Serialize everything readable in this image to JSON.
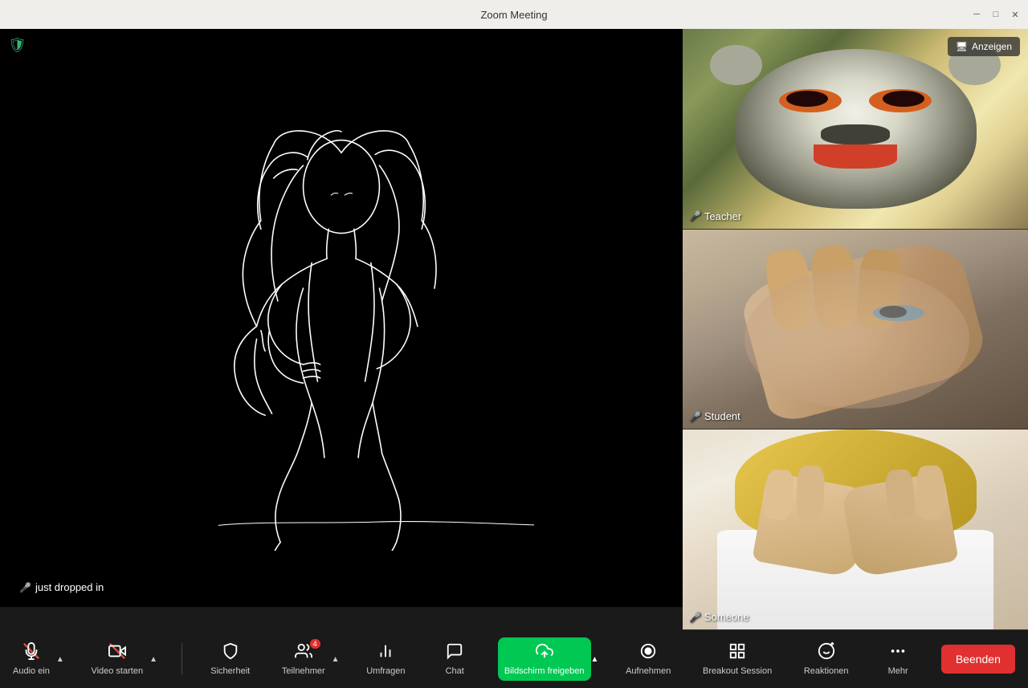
{
  "window": {
    "title": "Zoom Meeting"
  },
  "titlebar": {
    "minimize_label": "─",
    "restore_label": "□",
    "close_label": "✕"
  },
  "header": {
    "anzeigen_label": "Anzeigen",
    "monitor_icon": "🖥"
  },
  "main_video": {
    "participant_name": "just dropped in",
    "mic_status": "muted"
  },
  "participants": [
    {
      "id": "teacher",
      "name": "Teacher",
      "mic_status": "muted"
    },
    {
      "id": "student",
      "name": "Student",
      "mic_status": "muted"
    },
    {
      "id": "someone",
      "name": "Someone",
      "mic_status": "muted"
    }
  ],
  "toolbar": {
    "buttons": [
      {
        "id": "audio",
        "label": "Audio ein",
        "icon": "mic_off",
        "has_arrow": true,
        "active": false
      },
      {
        "id": "video",
        "label": "Video starten",
        "icon": "videocam_off",
        "has_arrow": true,
        "active": false
      },
      {
        "id": "security",
        "label": "Sicherheit",
        "icon": "shield",
        "has_arrow": false,
        "active": false
      },
      {
        "id": "participants",
        "label": "Teilnehmer",
        "icon": "people",
        "has_arrow": true,
        "active": false,
        "badge": "4"
      },
      {
        "id": "polls",
        "label": "Umfragen",
        "icon": "bar_chart",
        "has_arrow": false,
        "active": false
      },
      {
        "id": "chat",
        "label": "Chat",
        "icon": "chat_bubble",
        "has_arrow": false,
        "active": false
      },
      {
        "id": "share",
        "label": "Bildschirm freigeben",
        "icon": "share_screen",
        "has_arrow": true,
        "active": true
      },
      {
        "id": "record",
        "label": "Aufnehmen",
        "icon": "record",
        "has_arrow": false,
        "active": false
      },
      {
        "id": "breakout",
        "label": "Breakout Session",
        "icon": "grid",
        "has_arrow": false,
        "active": false
      },
      {
        "id": "reactions",
        "label": "Reaktionen",
        "icon": "emoji",
        "has_arrow": false,
        "active": false
      },
      {
        "id": "more",
        "label": "Mehr",
        "icon": "dots",
        "has_arrow": false,
        "active": false
      }
    ],
    "end_button_label": "Beenden",
    "colors": {
      "active": "#00c853",
      "end": "#e03030"
    }
  }
}
